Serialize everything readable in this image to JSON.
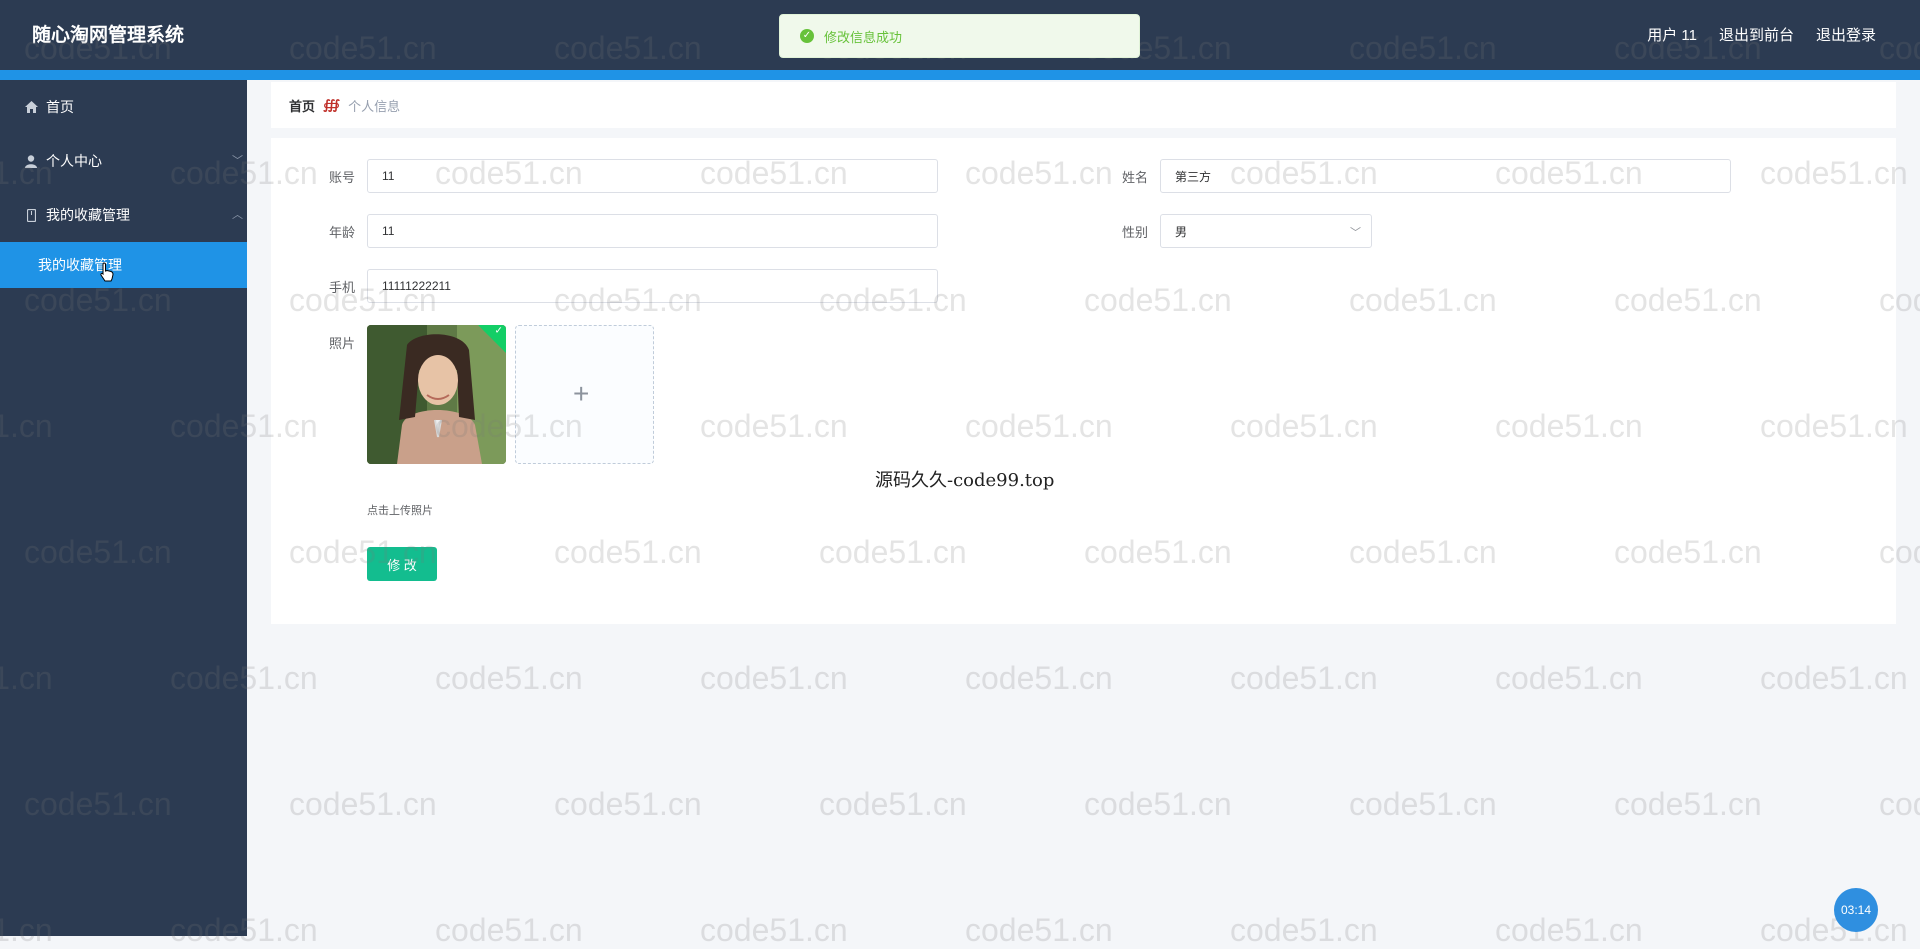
{
  "header": {
    "title": "随心淘网管理系统",
    "links": [
      "用户 11",
      "退出到前台",
      "退出登录"
    ]
  },
  "toast": {
    "message": "修改信息成功"
  },
  "sidebar": {
    "items": [
      {
        "label": "首页",
        "icon": "home-icon"
      },
      {
        "label": "个人中心",
        "icon": "user-icon"
      },
      {
        "label": "我的收藏管理",
        "icon": "bookmark-icon"
      }
    ],
    "active_subitem": "我的收藏管理"
  },
  "breadcrumb": {
    "home": "首页",
    "separator": "∰",
    "current": "个人信息"
  },
  "form": {
    "account": {
      "label": "账号",
      "value": "11"
    },
    "name": {
      "label": "姓名",
      "value": "第三方"
    },
    "age": {
      "label": "年龄",
      "value": "11"
    },
    "gender": {
      "label": "性别",
      "value": "男"
    },
    "phone": {
      "label": "手机",
      "value": "11111222211"
    },
    "photo": {
      "label": "照片",
      "hint": "点击上传照片",
      "upload_symbol": "+"
    },
    "submit_label": "修 改"
  },
  "site_note": "源码久久-code99.top",
  "watermark_text": "code51.cn",
  "timer": "03:14",
  "colors": {
    "header": "#2c3b52",
    "accent": "#1f93e6",
    "submit": "#13bd8f",
    "toast": "#67c23a"
  }
}
